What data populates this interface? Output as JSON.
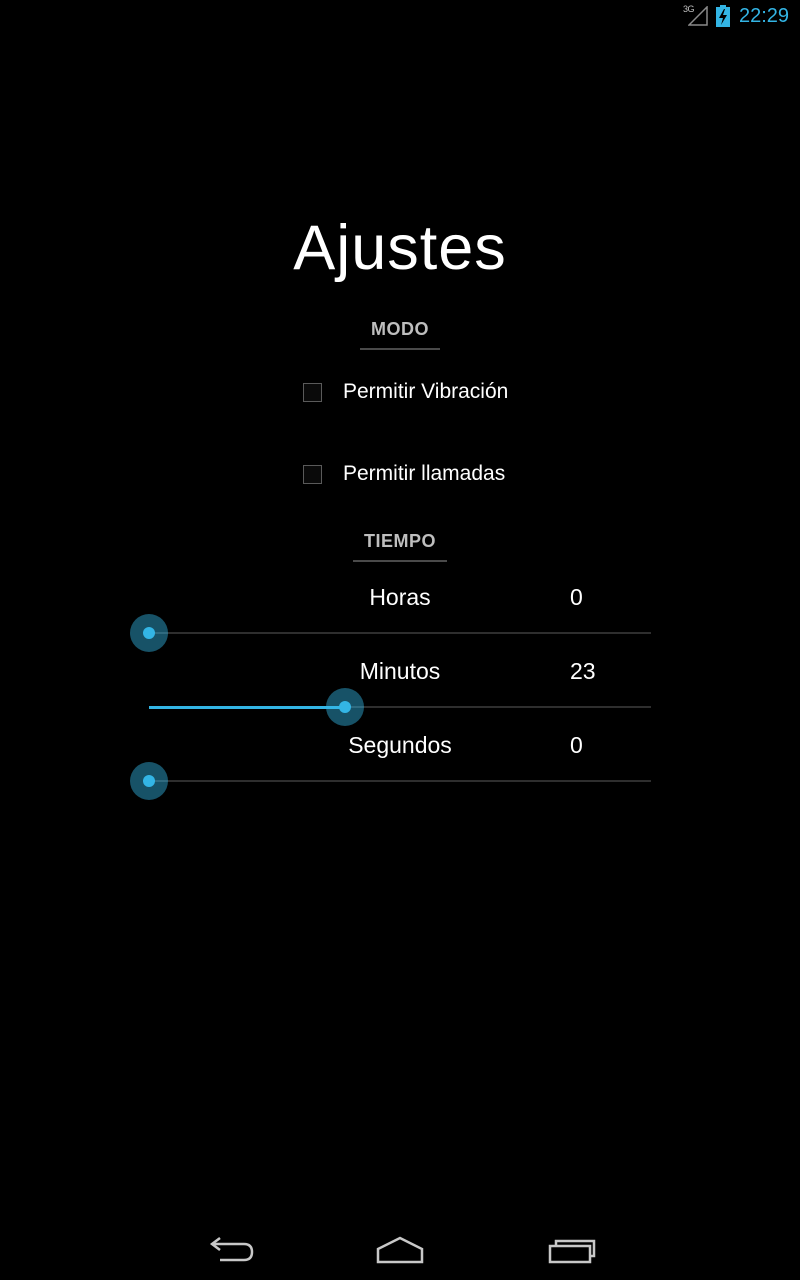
{
  "status_bar": {
    "network_label": "3G",
    "time": "22:29",
    "accent_color": "#33b5e5",
    "icons": [
      "signal-icon",
      "battery-charging-icon"
    ]
  },
  "title": "Ajustes",
  "modo": {
    "header": "MODO",
    "options": [
      {
        "label": "Permitir Vibración",
        "checked": false
      },
      {
        "label": "Permitir llamadas",
        "checked": false
      }
    ]
  },
  "tiempo": {
    "header": "TIEMPO",
    "sliders": [
      {
        "label": "Horas",
        "value": "0",
        "position_fraction": 0.0
      },
      {
        "label": "Minutos",
        "value": "23",
        "position_fraction": 0.39
      },
      {
        "label": "Segundos",
        "value": "0",
        "position_fraction": 0.0
      }
    ]
  },
  "nav_bar": {
    "icons": [
      "back-icon",
      "home-icon",
      "recent-apps-icon"
    ]
  }
}
